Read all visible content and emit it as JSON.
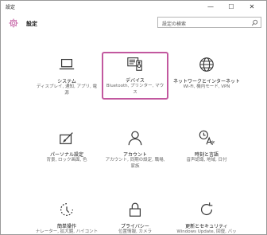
{
  "window": {
    "title": "設定",
    "minimize_glyph": "—",
    "maximize_glyph": "☐",
    "close_glyph": "✕"
  },
  "header": {
    "title": "設定",
    "icon": "gear-icon"
  },
  "search": {
    "placeholder": "設定の検索",
    "icon": "search-icon"
  },
  "accent_color": "#c2589f",
  "tiles": [
    {
      "title": "システム",
      "desc": "ディスプレイ, 通知, アプリ, 電源",
      "icon": "laptop-icon",
      "selected": false
    },
    {
      "title": "デバイス",
      "desc": "Bluetooth, プリンター, マウス",
      "icon": "devices-icon",
      "selected": true
    },
    {
      "title": "ネットワークとインターネット",
      "desc": "Wi-Fi, 機内モード, VPN",
      "icon": "globe-icon",
      "selected": false
    },
    {
      "title": "パーソナル設定",
      "desc": "背景, ロック画面, 色",
      "icon": "personalization-icon",
      "selected": false
    },
    {
      "title": "アカウント",
      "desc": "アカウント, 同期の設定, 職場, 家族",
      "icon": "person-icon",
      "selected": false
    },
    {
      "title": "時刻と言語",
      "desc": "音声認識, 地域, 日付",
      "icon": "time-language-icon",
      "selected": false
    },
    {
      "title": "簡単操作",
      "desc": "ナレーター, 拡大鏡, ハイコントラスト",
      "icon": "ease-of-access-icon",
      "selected": false
    },
    {
      "title": "プライバシー",
      "desc": "位置情報, カメラ",
      "icon": "lock-icon",
      "selected": false
    },
    {
      "title": "更新とセキュリティ",
      "desc": "Windows Update, 回復, バックアップ",
      "icon": "refresh-icon",
      "selected": false
    }
  ]
}
